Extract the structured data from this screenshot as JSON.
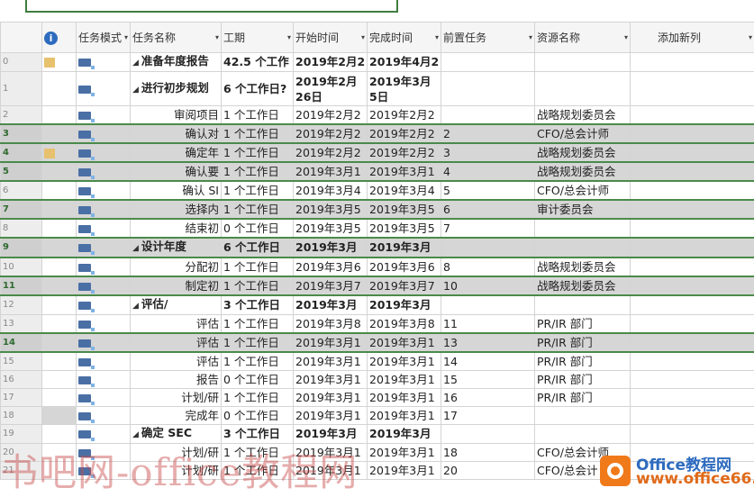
{
  "headers": {
    "info": "i",
    "mode": "任务模式",
    "name": "任务名称",
    "duration": "工期",
    "start": "开始时间",
    "finish": "完成时间",
    "pred": "前置任务",
    "resource": "资源名称",
    "add": "添加新列"
  },
  "rows": [
    {
      "id": "0",
      "name": "准备年度报告",
      "summary": true,
      "duration": "42.5 个工作",
      "start": "2019年2月2",
      "finish": "2019年4月2",
      "pred": "",
      "resource": "",
      "note": true
    },
    {
      "id": "1",
      "name": "进行初步规划",
      "summary": true,
      "duration": "6 个工作日?",
      "start": "2019年2月26日",
      "finish": "2019年3月5日",
      "pred": "",
      "resource": "",
      "tall": true
    },
    {
      "id": "2",
      "name": "审阅项目",
      "duration": "1 个工作日",
      "start": "2019年2月2",
      "finish": "2019年2月2",
      "pred": "",
      "resource": "战略规划委员会"
    },
    {
      "id": "3",
      "name": "确认对",
      "duration": "1 个工作日",
      "start": "2019年2月2",
      "finish": "2019年2月2",
      "pred": "2",
      "resource": "CFO/总会计师",
      "sel": true
    },
    {
      "id": "4",
      "name": "确定年",
      "duration": "1 个工作日",
      "start": "2019年2月2",
      "finish": "2019年2月2",
      "pred": "3",
      "resource": "战略规划委员会",
      "sel": true,
      "note": true
    },
    {
      "id": "5",
      "name": "确认要",
      "duration": "1 个工作日",
      "start": "2019年3月1",
      "finish": "2019年3月1",
      "pred": "4",
      "resource": "战略规划委员会",
      "sel": true
    },
    {
      "id": "6",
      "name": "确认 SI",
      "duration": "1 个工作日",
      "start": "2019年3月4",
      "finish": "2019年3月4",
      "pred": "5",
      "resource": "CFO/总会计师"
    },
    {
      "id": "7",
      "name": "选择内",
      "duration": "1 个工作日",
      "start": "2019年3月5",
      "finish": "2019年3月5",
      "pred": "6",
      "resource": "审计委员会",
      "sel": true
    },
    {
      "id": "8",
      "name": "结束初",
      "duration": "0 个工作日",
      "start": "2019年3月5",
      "finish": "2019年3月5",
      "pred": "7",
      "resource": ""
    },
    {
      "id": "9",
      "name": "设计年度",
      "summary": true,
      "duration": "6 个工作日",
      "start": "2019年3月",
      "finish": "2019年3月",
      "pred": "",
      "resource": "",
      "sel": true
    },
    {
      "id": "10",
      "name": "分配初",
      "duration": "1 个工作日",
      "start": "2019年3月6",
      "finish": "2019年3月6",
      "pred": "8",
      "resource": "战略规划委员会"
    },
    {
      "id": "11",
      "name": "制定初",
      "duration": "1 个工作日",
      "start": "2019年3月7",
      "finish": "2019年3月7",
      "pred": "10",
      "resource": "战略规划委员会",
      "sel": true
    },
    {
      "id": "12",
      "name": "评估/",
      "summary": true,
      "duration": "3 个工作日",
      "start": "2019年3月",
      "finish": "2019年3月",
      "pred": "",
      "resource": ""
    },
    {
      "id": "13",
      "name": "评估",
      "duration": "1 个工作日",
      "start": "2019年3月8",
      "finish": "2019年3月8",
      "pred": "11",
      "resource": "PR/IR 部门"
    },
    {
      "id": "14",
      "name": "评估",
      "duration": "1 个工作日",
      "start": "2019年3月1",
      "finish": "2019年3月1",
      "pred": "13",
      "resource": "PR/IR 部门",
      "sel": true
    },
    {
      "id": "15",
      "name": "评估",
      "duration": "1 个工作日",
      "start": "2019年3月1",
      "finish": "2019年3月1",
      "pred": "14",
      "resource": "PR/IR 部门"
    },
    {
      "id": "16",
      "name": "报告",
      "duration": "0 个工作日",
      "start": "2019年3月1",
      "finish": "2019年3月1",
      "pred": "15",
      "resource": "PR/IR 部门"
    },
    {
      "id": "17",
      "name": "计划/研",
      "duration": "1 个工作日",
      "start": "2019年3月1",
      "finish": "2019年3月1",
      "pred": "16",
      "resource": "PR/IR 部门"
    },
    {
      "id": "18",
      "name": "完成年",
      "duration": "0 个工作日",
      "start": "2019年3月1",
      "finish": "2019年3月1",
      "pred": "17",
      "resource": "",
      "selcell": true
    },
    {
      "id": "19",
      "name": "确定 SEC",
      "summary": true,
      "duration": "3 个工作日",
      "start": "2019年3月",
      "finish": "2019年3月",
      "pred": "",
      "resource": ""
    },
    {
      "id": "20",
      "name": "计划/研",
      "duration": "1 个工作日",
      "start": "2019年3月1",
      "finish": "2019年3月1",
      "pred": "18",
      "resource": "CFO/总会计师"
    },
    {
      "id": "21",
      "name": "计划/研",
      "duration": "1 个工作日",
      "start": "2019年3月1",
      "finish": "2019年3月1",
      "pred": "20",
      "resource": "CFO/总会计"
    }
  ],
  "watermark": "书吧网-office教程网",
  "brand": {
    "line1": "Office教程网",
    "line2": "www.office66.cn"
  }
}
